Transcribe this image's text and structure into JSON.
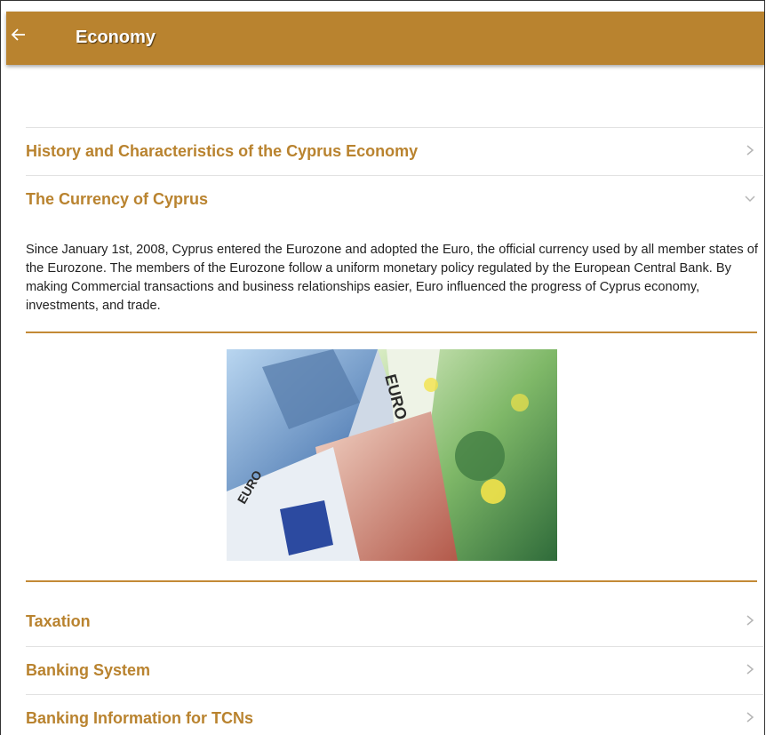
{
  "appbar": {
    "title": "Economy",
    "back_icon": "arrow-left-icon",
    "color": "#b9832f"
  },
  "sections": [
    {
      "label": "History and Characteristics of the Cyprus Economy",
      "state": "collapsed"
    },
    {
      "label": "The Currency of Cyprus",
      "state": "expanded"
    },
    {
      "label": "Taxation",
      "state": "collapsed"
    },
    {
      "label": "Banking System",
      "state": "collapsed"
    },
    {
      "label": "Banking Information for TCNs",
      "state": "collapsed"
    }
  ],
  "currency": {
    "text": "Since January 1st, 2008, Cyprus entered the Eurozone and adopted the Euro, the official currency used by all member states of the Eurozone. The members of the Eurozone follow a uniform monetary policy regulated by the European Central Bank. By making Commercial transactions and business relationships easier, Euro influenced the progress of Cyprus economy, investments, and trade.",
    "image": "euro-banknotes-photo"
  },
  "colors": {
    "accent": "#b9832f",
    "divider": "#c38a36",
    "text": "#222222"
  }
}
